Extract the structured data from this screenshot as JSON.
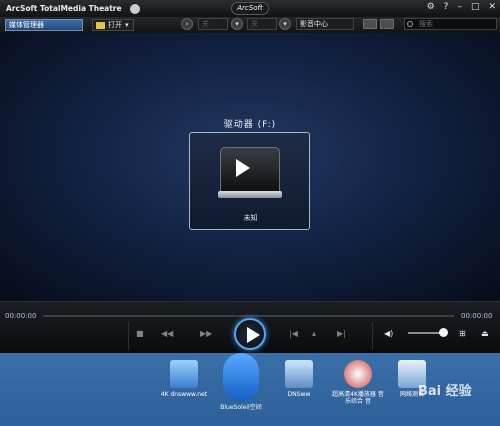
{
  "titlebar": {
    "app_title": "ArcSoft TotalMedia Theatre",
    "logo_text": "ArcSoft",
    "help": "?",
    "min": "–",
    "max": "□",
    "close": "✕",
    "gear": "⚙"
  },
  "toolbar": {
    "media_manager": "媒体管理器",
    "open": "打开",
    "dd1": "关",
    "dd2": "关",
    "dd3": "影音中心",
    "search_placeholder": "搜索"
  },
  "main": {
    "drive_label": "驱动器 (F:)",
    "drive_name": "未知"
  },
  "player": {
    "time_left": "00:00:00",
    "time_right": "00:00:00"
  },
  "desktop": {
    "icons": [
      {
        "label": "4K dnswww.net"
      },
      {
        "label": "BlueSoleil空间"
      },
      {
        "label": "DNSww"
      },
      {
        "label": "超高清4K播放器 音乐综合 音"
      },
      {
        "label": "网络测试"
      }
    ],
    "watermark": "Bai 经验"
  },
  "colors": {
    "accent": "#5aa5ea",
    "desktop": "#3b6fa7",
    "titlebar": "#1a1c1f"
  }
}
